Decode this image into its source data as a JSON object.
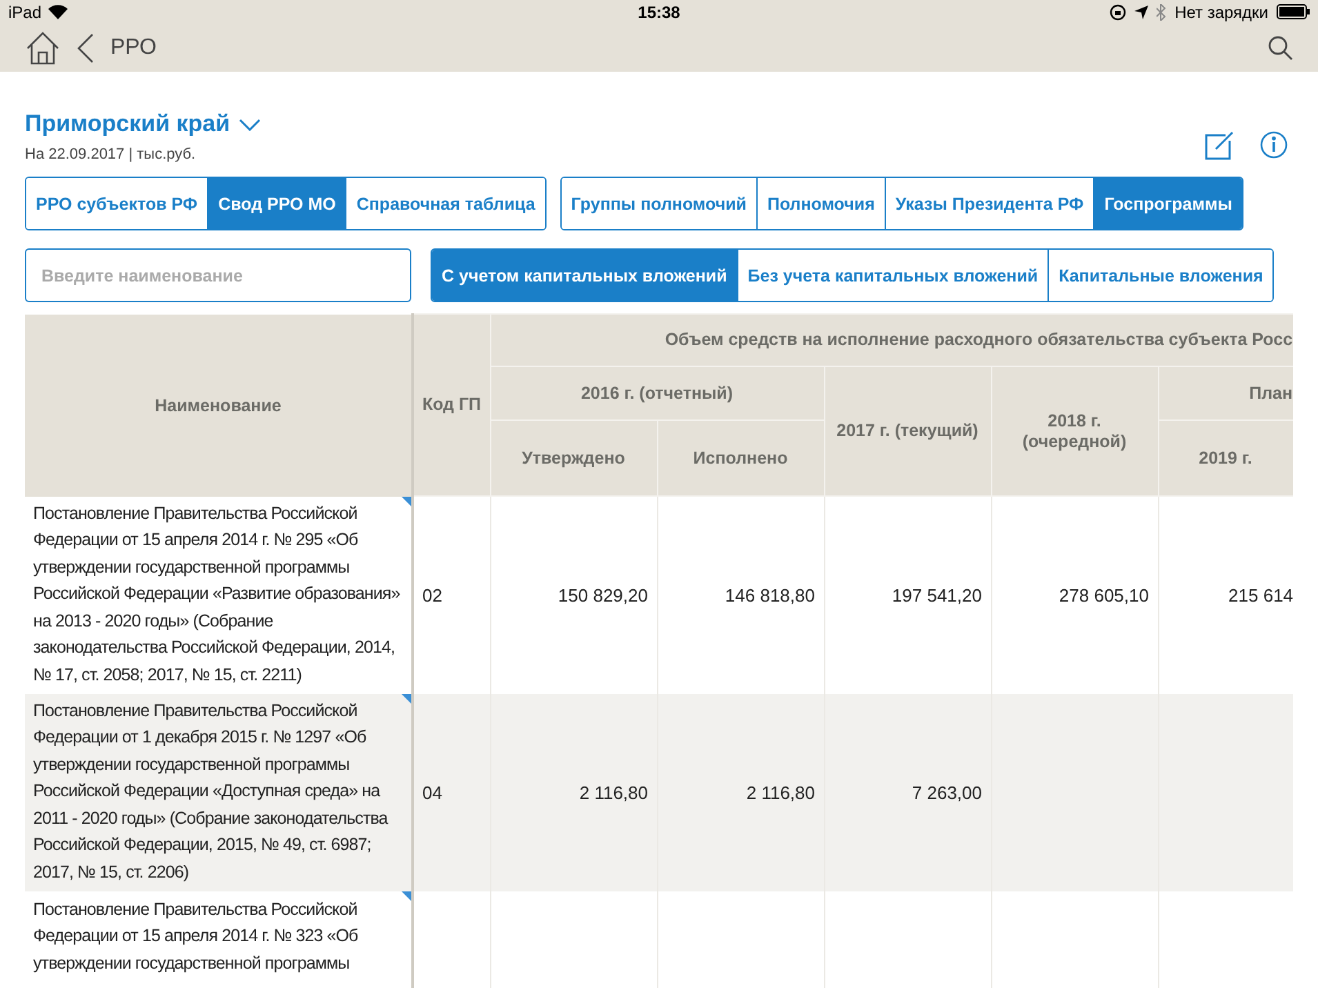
{
  "status_bar": {
    "carrier": "iPad",
    "time": "15:38",
    "battery_text": "Нет зарядки"
  },
  "nav": {
    "title": "РРО"
  },
  "header": {
    "region": "Приморский край",
    "subtitle": "На 22.09.2017 | тыс.руб."
  },
  "segments_left": [
    {
      "label": "РРО субъектов РФ",
      "selected": false
    },
    {
      "label": "Свод РРО МО",
      "selected": true
    },
    {
      "label": "Справочная таблица",
      "selected": false
    }
  ],
  "segments_right": [
    {
      "label": "Группы полномочий",
      "selected": false
    },
    {
      "label": "Полномочия",
      "selected": false
    },
    {
      "label": "Указы Президента РФ",
      "selected": false
    },
    {
      "label": "Госпрограммы",
      "selected": true
    }
  ],
  "search": {
    "placeholder": "Введите наименование"
  },
  "mode_tabs": [
    {
      "label": "С учетом капитальных вложений",
      "selected": true
    },
    {
      "label": "Без учета капитальных вложений",
      "selected": false
    },
    {
      "label": "Капитальные вложения",
      "selected": false
    }
  ],
  "table": {
    "col_name": "Наименование",
    "col_code": "Код ГП",
    "group_title": "Объем средств на исполнение расходного обязательства субъекта Росс",
    "year_2016": "2016 г. (отчетный)",
    "approved": "Утверждено",
    "executed": "Исполнено",
    "year_2017": "2017 г. (текущий)",
    "year_2018": "2018 г. (очередной)",
    "plan": "План",
    "year_2019": "2019 г.",
    "rows": [
      {
        "name": "Постановление Правительства Российской Федерации от 15 апреля 2014 г. № 295 «Об утверждении государственной программы Российской Федерации «Развитие образования» на 2013 - 2020 годы» (Собрание законодательства Российской Федерации, 2014, № 17, ст. 2058; 2017, № 15, ст. 2211)",
        "code": "02",
        "values": [
          "150 829,20",
          "146 818,80",
          "197 541,20",
          "278 605,10",
          "215 614"
        ]
      },
      {
        "name": "Постановление Правительства Российской Федерации от 1 декабря 2015 г. № 1297 «Об утверждении государственной программы Российской Федерации «Доступная среда» на 2011 - 2020 годы» (Собрание законодательства Российской Федерации, 2015, № 49, ст. 6987; 2017, № 15, ст. 2206)",
        "code": "04",
        "values": [
          "2 116,80",
          "2 116,80",
          "7 263,00"
        ]
      },
      {
        "name": "Постановление Правительства Российской Федерации от 15 апреля 2014 г. № 323 «Об утверждении государственной программы"
      }
    ]
  }
}
